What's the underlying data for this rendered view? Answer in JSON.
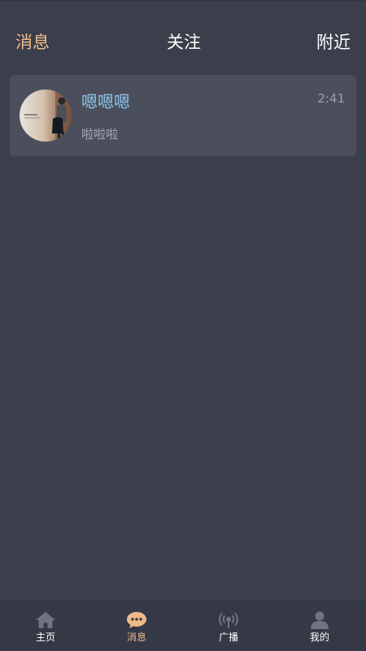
{
  "header": {
    "tabs": [
      {
        "label": "消息",
        "active": true
      },
      {
        "label": "关注",
        "active": false
      },
      {
        "label": "附近",
        "active": false
      }
    ]
  },
  "conversations": [
    {
      "name": "嗯嗯嗯",
      "time": "2:41",
      "preview": "啦啦啦"
    }
  ],
  "bottom_nav": {
    "items": [
      {
        "label": "主页",
        "icon": "home-icon",
        "active": false
      },
      {
        "label": "消息",
        "icon": "chat-bubble-icon",
        "active": true
      },
      {
        "label": "广播",
        "icon": "broadcast-icon",
        "active": false
      },
      {
        "label": "我的",
        "icon": "person-icon",
        "active": false
      }
    ]
  },
  "colors": {
    "background": "#3a3f4b",
    "card": "#4a4f5b",
    "accent": "#f0b988",
    "name": "#8ec6ef",
    "nav_inactive": "#6e7480"
  }
}
